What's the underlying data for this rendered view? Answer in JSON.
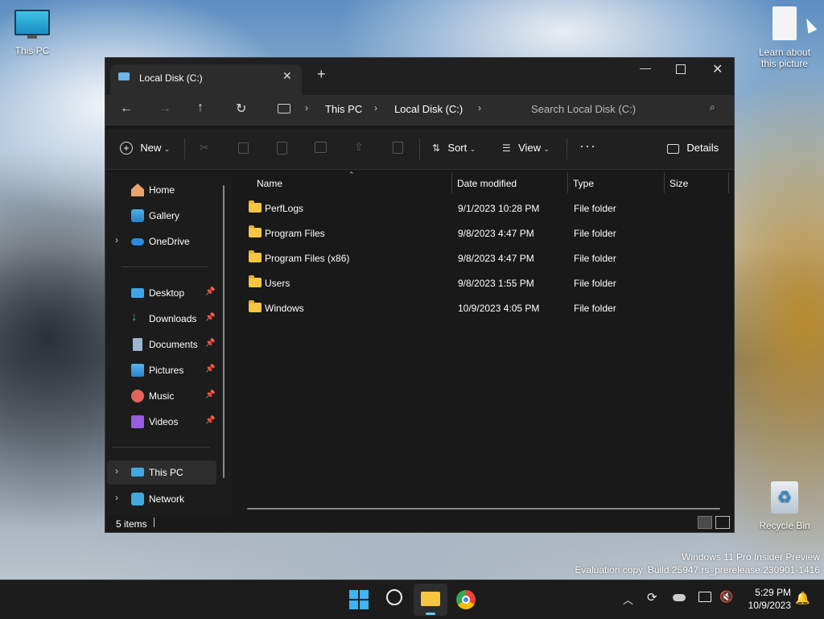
{
  "desktop": {
    "this_pc": "This PC",
    "learn": "Learn about\nthis picture",
    "recycle_bin": "Recycle Bin",
    "watermark_line1": "Windows 11 Pro Insider Preview",
    "watermark_line2": "Evaluation copy. Build 25947.rs_prerelease.230901-1416"
  },
  "window": {
    "tab_title": "Local Disk (C:)",
    "breadcrumb": [
      "This PC",
      "Local Disk (C:)"
    ],
    "search_placeholder": "Search Local Disk (C:)",
    "toolbar": {
      "new": "New",
      "sort": "Sort",
      "view": "View",
      "details": "Details"
    },
    "nav": {
      "home": "Home",
      "gallery": "Gallery",
      "onedrive": "OneDrive",
      "desktop": "Desktop",
      "downloads": "Downloads",
      "documents": "Documents",
      "pictures": "Pictures",
      "music": "Music",
      "videos": "Videos",
      "this_pc": "This PC",
      "network": "Network"
    },
    "columns": [
      "Name",
      "Date modified",
      "Type",
      "Size"
    ],
    "rows": [
      {
        "name": "PerfLogs",
        "date": "9/1/2023 10:28 PM",
        "type": "File folder"
      },
      {
        "name": "Program Files",
        "date": "9/8/2023 4:47 PM",
        "type": "File folder"
      },
      {
        "name": "Program Files (x86)",
        "date": "9/8/2023 4:47 PM",
        "type": "File folder"
      },
      {
        "name": "Users",
        "date": "9/8/2023 1:55 PM",
        "type": "File folder"
      },
      {
        "name": "Windows",
        "date": "10/9/2023 4:05 PM",
        "type": "File folder"
      }
    ],
    "status": "5 items"
  },
  "taskbar": {
    "time": "5:29 PM",
    "date": "10/9/2023"
  },
  "colors": {
    "accent": "#60cdff",
    "folder": "#f6c542",
    "window_bg": "#191919"
  }
}
